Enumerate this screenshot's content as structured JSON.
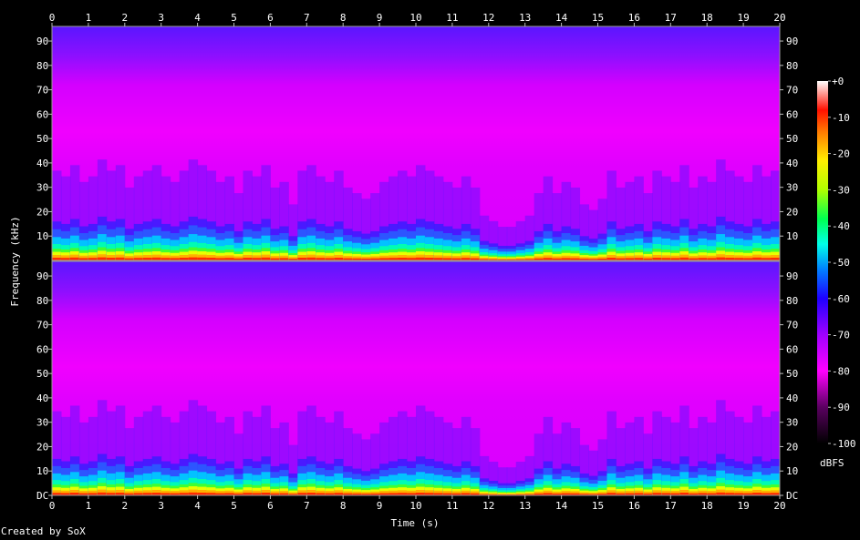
{
  "chart_data": {
    "type": "heatmap",
    "title": "",
    "xlabel": "Time (s)",
    "ylabel": "Frequency (kHz)",
    "xlim": [
      0,
      20
    ],
    "ylim": [
      0,
      96
    ],
    "x_ticks": [
      0,
      1,
      2,
      3,
      4,
      5,
      6,
      7,
      8,
      9,
      10,
      11,
      12,
      13,
      14,
      15,
      16,
      17,
      18,
      19,
      20
    ],
    "y_ticks_upper": [
      10,
      20,
      30,
      40,
      50,
      60,
      70,
      80,
      90
    ],
    "y_ticks_lower": [
      "DC",
      10,
      20,
      30,
      40,
      50,
      60,
      70,
      80,
      90
    ],
    "channels": 2,
    "colorbar": {
      "label": "dBFS",
      "range": [
        -100,
        0
      ],
      "ticks": [
        "+0",
        "-10",
        "-20",
        "-30",
        "-40",
        "-50",
        "-60",
        "-70",
        "-80",
        "-90",
        "-100"
      ],
      "colors": [
        "#ffffff",
        "#ff1a00",
        "#ffaa00",
        "#fff200",
        "#7dff00",
        "#00ff60",
        "#00ffe0",
        "#0080ff",
        "#2000ff",
        "#a000ff",
        "#ff00ff",
        "#000000"
      ]
    },
    "series": [
      {
        "energy_kHz": [
          16,
          15,
          17,
          14,
          15,
          18,
          16,
          17,
          13,
          15,
          16,
          17,
          15,
          14,
          16,
          18,
          17,
          16,
          14,
          15,
          12,
          16,
          15,
          17,
          13,
          14,
          10,
          16,
          17,
          15,
          14,
          16,
          13,
          12,
          11,
          12,
          14,
          15,
          16,
          15,
          17,
          16,
          15,
          14,
          13,
          15,
          13,
          8,
          7,
          6,
          6,
          7,
          8,
          12,
          15,
          12,
          14,
          13,
          10,
          9,
          11,
          16,
          13,
          14,
          15,
          12,
          16,
          15,
          14,
          17,
          13,
          15,
          14,
          18,
          16,
          15,
          14,
          17,
          15,
          16
        ]
      },
      {
        "energy_kHz": [
          15,
          14,
          16,
          13,
          14,
          17,
          15,
          16,
          12,
          14,
          15,
          16,
          14,
          13,
          15,
          17,
          16,
          15,
          13,
          14,
          11,
          15,
          14,
          16,
          12,
          13,
          9,
          15,
          16,
          14,
          13,
          15,
          12,
          11,
          10,
          11,
          13,
          14,
          15,
          14,
          16,
          15,
          14,
          13,
          12,
          14,
          12,
          7,
          6,
          5,
          5,
          6,
          7,
          11,
          14,
          11,
          13,
          12,
          9,
          8,
          10,
          15,
          12,
          13,
          14,
          11,
          15,
          14,
          13,
          16,
          12,
          14,
          13,
          17,
          15,
          14,
          13,
          16,
          14,
          15
        ]
      }
    ]
  },
  "footer": {
    "credit": "Created by SoX"
  }
}
